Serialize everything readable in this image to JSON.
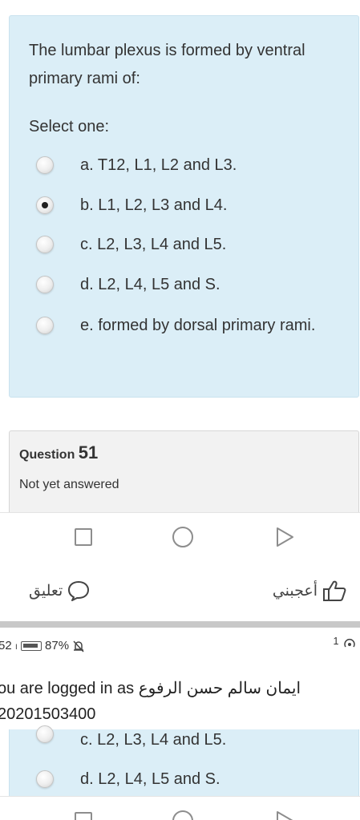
{
  "question": {
    "text": "The lumbar plexus is formed by ventral primary rami of:",
    "select_label": "Select one:",
    "options": [
      {
        "label": "a. T12, L1, L2 and L3.",
        "checked": false
      },
      {
        "label": "b. L1, L2, L3 and L4.",
        "checked": true
      },
      {
        "label": "c. L2, L3, L4 and L5.",
        "checked": false
      },
      {
        "label": "d. L2, L4, L5 and S.",
        "checked": false
      },
      {
        "label": "e. formed by dorsal primary rami.",
        "checked": false
      }
    ]
  },
  "next_question": {
    "prefix": "Question",
    "number": "51",
    "status": "Not yet answered"
  },
  "social": {
    "comment": "تعليق",
    "like": "أعجبني"
  },
  "second_screen": {
    "status_left": "52",
    "battery": "87%",
    "status_right_sup": "1",
    "logged_in_text": "ou are logged in as ايمان سالم حسن الرفوع",
    "student_id": "20201503400",
    "options": [
      {
        "label": "c. L2, L3, L4 and L5."
      },
      {
        "label": "d. L2, L4, L5 and S."
      }
    ]
  },
  "colors": {
    "question_bg": "#dbeef7",
    "info_bg": "#f2f2f2",
    "nav_icon": "#8d8d8d"
  }
}
